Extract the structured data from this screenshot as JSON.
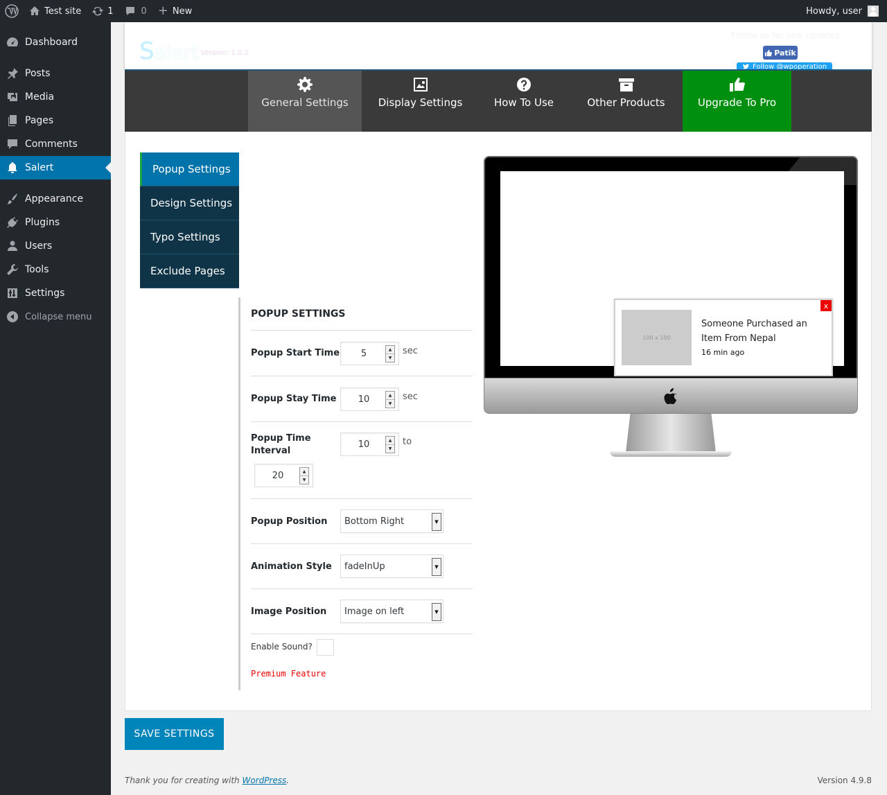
{
  "adminbar": {
    "site_name": "Test site",
    "updates_count": "1",
    "comments_count": "0",
    "new_label": "New",
    "howdy": "Howdy, user"
  },
  "menu": {
    "dashboard": "Dashboard",
    "posts": "Posts",
    "media": "Media",
    "pages": "Pages",
    "comments": "Comments",
    "salert": "Salert",
    "appearance": "Appearance",
    "plugins": "Plugins",
    "users": "Users",
    "tools": "Tools",
    "settings": "Settings",
    "collapse": "Collapse menu"
  },
  "plugin": {
    "logo_first": "S",
    "logo_rest": "alert",
    "version": "Version: 1.0.2",
    "follow_text": "Follow us for new updates",
    "fb_label": "Patīk",
    "twitter_label": "Follow @wpoperation"
  },
  "tabs": {
    "general": "General Settings",
    "display": "Display Settings",
    "howto": "How To Use",
    "other": "Other Products",
    "pro": "Upgrade To Pro"
  },
  "subtabs": {
    "popup": "Popup Settings",
    "design": "Design Settings",
    "typo": "Typo Settings",
    "exclude": "Exclude Pages"
  },
  "form": {
    "heading": "POPUP SETTINGS",
    "start_time_label": "Popup Start Time",
    "start_time_value": "5",
    "start_time_unit": "sec",
    "stay_time_label": "Popup Stay Time",
    "stay_time_value": "10",
    "stay_time_unit": "sec",
    "interval_label_1": "Popup Time",
    "interval_label_2": "Interval",
    "interval_from": "10",
    "interval_to_word": "to",
    "interval_to": "20",
    "position_label": "Popup Position",
    "position_value": "Bottom Right",
    "animation_label": "Animation Style",
    "animation_value": "fadeInUp",
    "image_pos_label": "Image Position",
    "image_pos_value": "Image on left",
    "sound_label": "Enable Sound?",
    "premium": "Premium Feature"
  },
  "preview": {
    "thumb": "100 x 100",
    "message": "Someone Purchased an Item From Nepal",
    "time": "16 min ago",
    "close": "x"
  },
  "save_label": "SAVE SETTINGS",
  "footer": {
    "thanks_prefix": "Thank you for creating with ",
    "wp_link": "WordPress",
    "thanks_suffix": ".",
    "version": "Version 4.9.8"
  },
  "colors": {
    "admin_bg": "#23282d",
    "accent": "#0073aa",
    "pro_green": "#018f0f",
    "subtab_bg": "#0f3447",
    "premium_red": "#ee0000"
  }
}
